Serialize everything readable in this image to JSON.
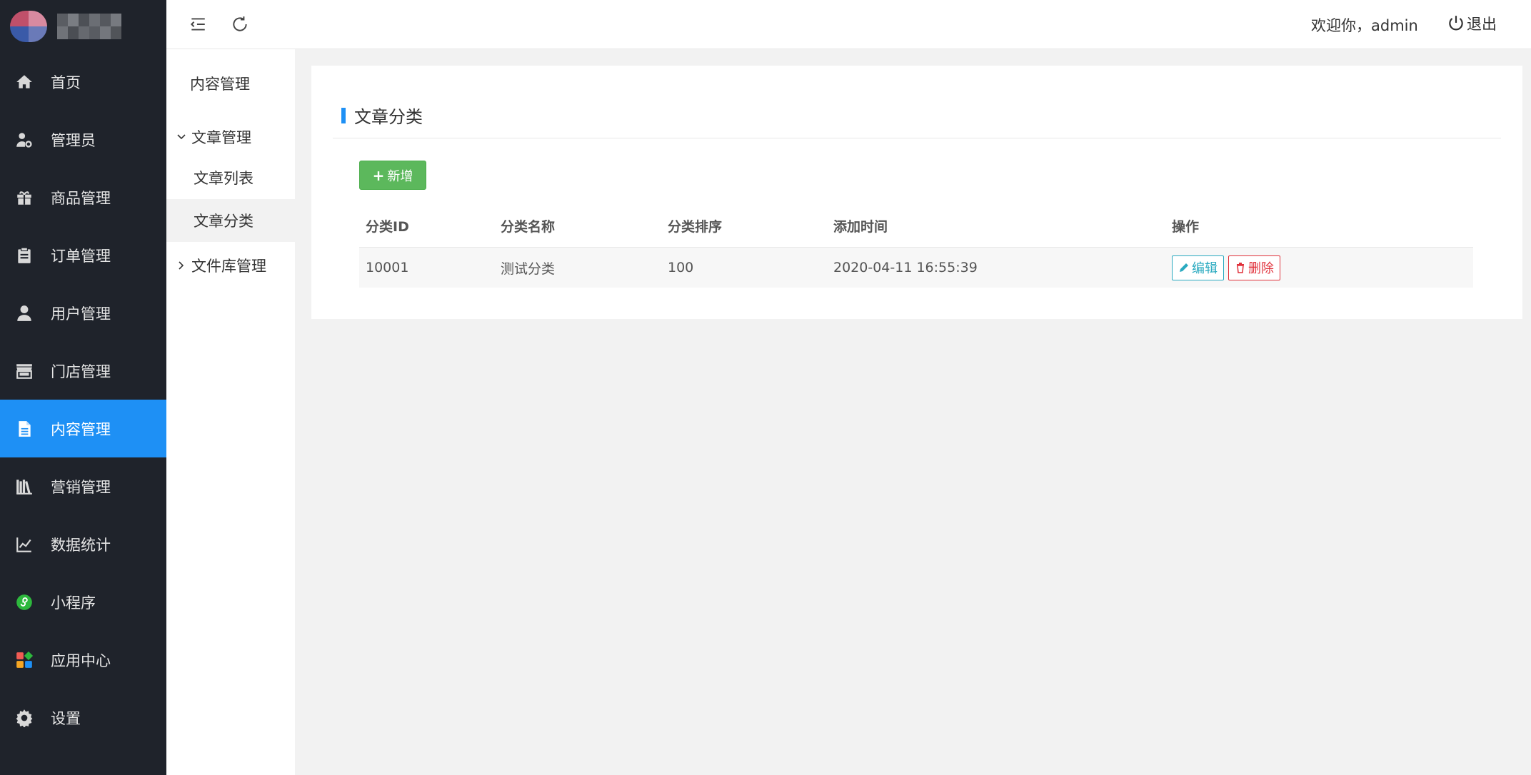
{
  "colors": {
    "sidebar_bg": "#1f232b",
    "accent": "#1e90f5",
    "add_button": "#5cb85c",
    "edit": "#2aaac0",
    "delete": "#e0303a",
    "miniprogram_icon": "#2db83d"
  },
  "sidebar": {
    "items": [
      {
        "label": "首页",
        "icon": "home-icon"
      },
      {
        "label": "管理员",
        "icon": "admin-user-gear-icon"
      },
      {
        "label": "商品管理",
        "icon": "gift-icon"
      },
      {
        "label": "订单管理",
        "icon": "clipboard-icon"
      },
      {
        "label": "用户管理",
        "icon": "user-icon"
      },
      {
        "label": "门店管理",
        "icon": "store-icon"
      },
      {
        "label": "内容管理",
        "icon": "document-icon",
        "active": true
      },
      {
        "label": "营销管理",
        "icon": "books-icon"
      },
      {
        "label": "数据统计",
        "icon": "line-chart-icon"
      },
      {
        "label": "小程序",
        "icon": "miniprogram-icon"
      },
      {
        "label": "应用中心",
        "icon": "apps-icon"
      },
      {
        "label": "设置",
        "icon": "gear-icon"
      }
    ]
  },
  "header": {
    "welcome": "欢迎你，admin",
    "logout": "退出"
  },
  "submenu": {
    "title": "内容管理",
    "groups": [
      {
        "label": "文章管理",
        "expanded": true,
        "items": [
          {
            "label": "文章列表"
          },
          {
            "label": "文章分类",
            "active": true
          }
        ]
      },
      {
        "label": "文件库管理",
        "expanded": false
      }
    ]
  },
  "main": {
    "title": "文章分类",
    "add_button": "新增",
    "table": {
      "headers": [
        "分类ID",
        "分类名称",
        "分类排序",
        "添加时间",
        "操作"
      ],
      "rows": [
        {
          "id": "10001",
          "name": "测试分类",
          "sort": "100",
          "time": "2020-04-11 16:55:39",
          "edit": "编辑",
          "delete": "删除"
        }
      ]
    }
  }
}
